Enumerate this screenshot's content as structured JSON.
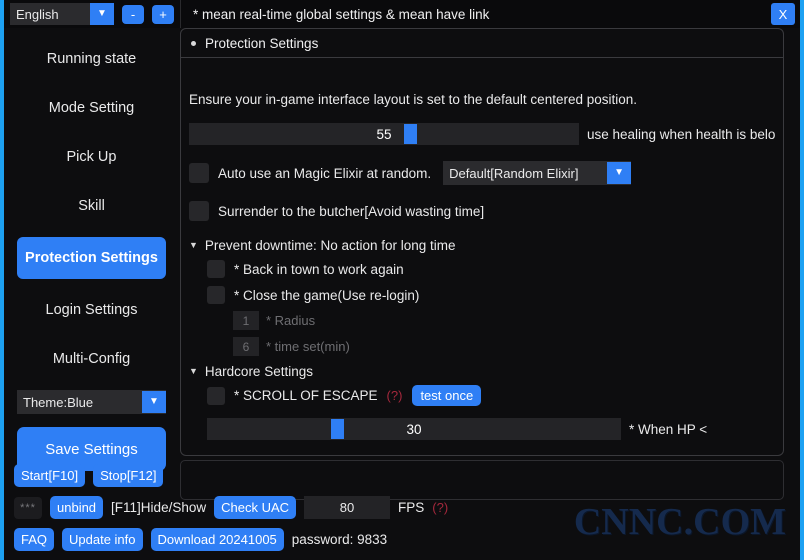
{
  "titlebar": {
    "language": "English",
    "dropdown_icon": "chevron-down-icon",
    "minus_label": "-",
    "plus_label": "+",
    "title": "* mean real-time global settings   & mean have link",
    "close_label": "X"
  },
  "sidebar": {
    "items": [
      {
        "label": "Running state",
        "active": false
      },
      {
        "label": "Mode Setting",
        "active": false
      },
      {
        "label": "Pick Up",
        "active": false
      },
      {
        "label": "Skill",
        "active": false
      },
      {
        "label": "Protection Settings",
        "active": true
      },
      {
        "label": "Login Settings",
        "active": false
      },
      {
        "label": "Multi-Config",
        "active": false
      }
    ],
    "theme": "Theme:Blue",
    "save_label": "Save Settings"
  },
  "panel": {
    "header": "Protection Settings",
    "info": "Ensure your in-game interface layout is set to the default centered position.",
    "health_slider": {
      "value": "55",
      "percent": 55,
      "label": "use healing when health is belo"
    },
    "elixir": {
      "label": "Auto use an Magic Elixir at random.",
      "option": "Default[Random Elixir]"
    },
    "surrender": {
      "label": "Surrender to the butcher[Avoid wasting time]"
    },
    "prevent_downtime": {
      "label": "Prevent downtime: No action for long time",
      "children": [
        {
          "label": "* Back in town to work again",
          "type": "checkbox"
        },
        {
          "label": "* Close the game(Use re-login)",
          "type": "checkbox"
        },
        {
          "label": "* Radius",
          "type": "number",
          "value": "1"
        },
        {
          "label": "* time set(min)",
          "type": "number",
          "value": "6"
        }
      ]
    },
    "hardcore": {
      "label": "Hardcore Settings",
      "scroll_label": "* SCROLL OF ESCAPE",
      "help": "(?)",
      "test_button": "test once",
      "hp_slider": {
        "value": "30",
        "percent": 30,
        "label": "* When HP <"
      }
    }
  },
  "bottom": {
    "start_label": "Start[F10]",
    "stop_label": "Stop[F12]",
    "pw_mask": "***",
    "unbind_label": "unbind",
    "hide_show_label": "[F11]Hide/Show",
    "check_uac_label": "Check UAC",
    "fps_value": "80",
    "fps_label": "FPS",
    "fps_help": "(?)",
    "faq_label": "FAQ",
    "update_label": "Update info",
    "download_label": "Download 20241005",
    "password_label": "password:  9833"
  },
  "watermark": "CNNC.COM",
  "colors": {
    "accent": "#2f7ff5",
    "border": "#1da1f2",
    "help_red": "#a4283c",
    "background": "#0d0d0f"
  }
}
